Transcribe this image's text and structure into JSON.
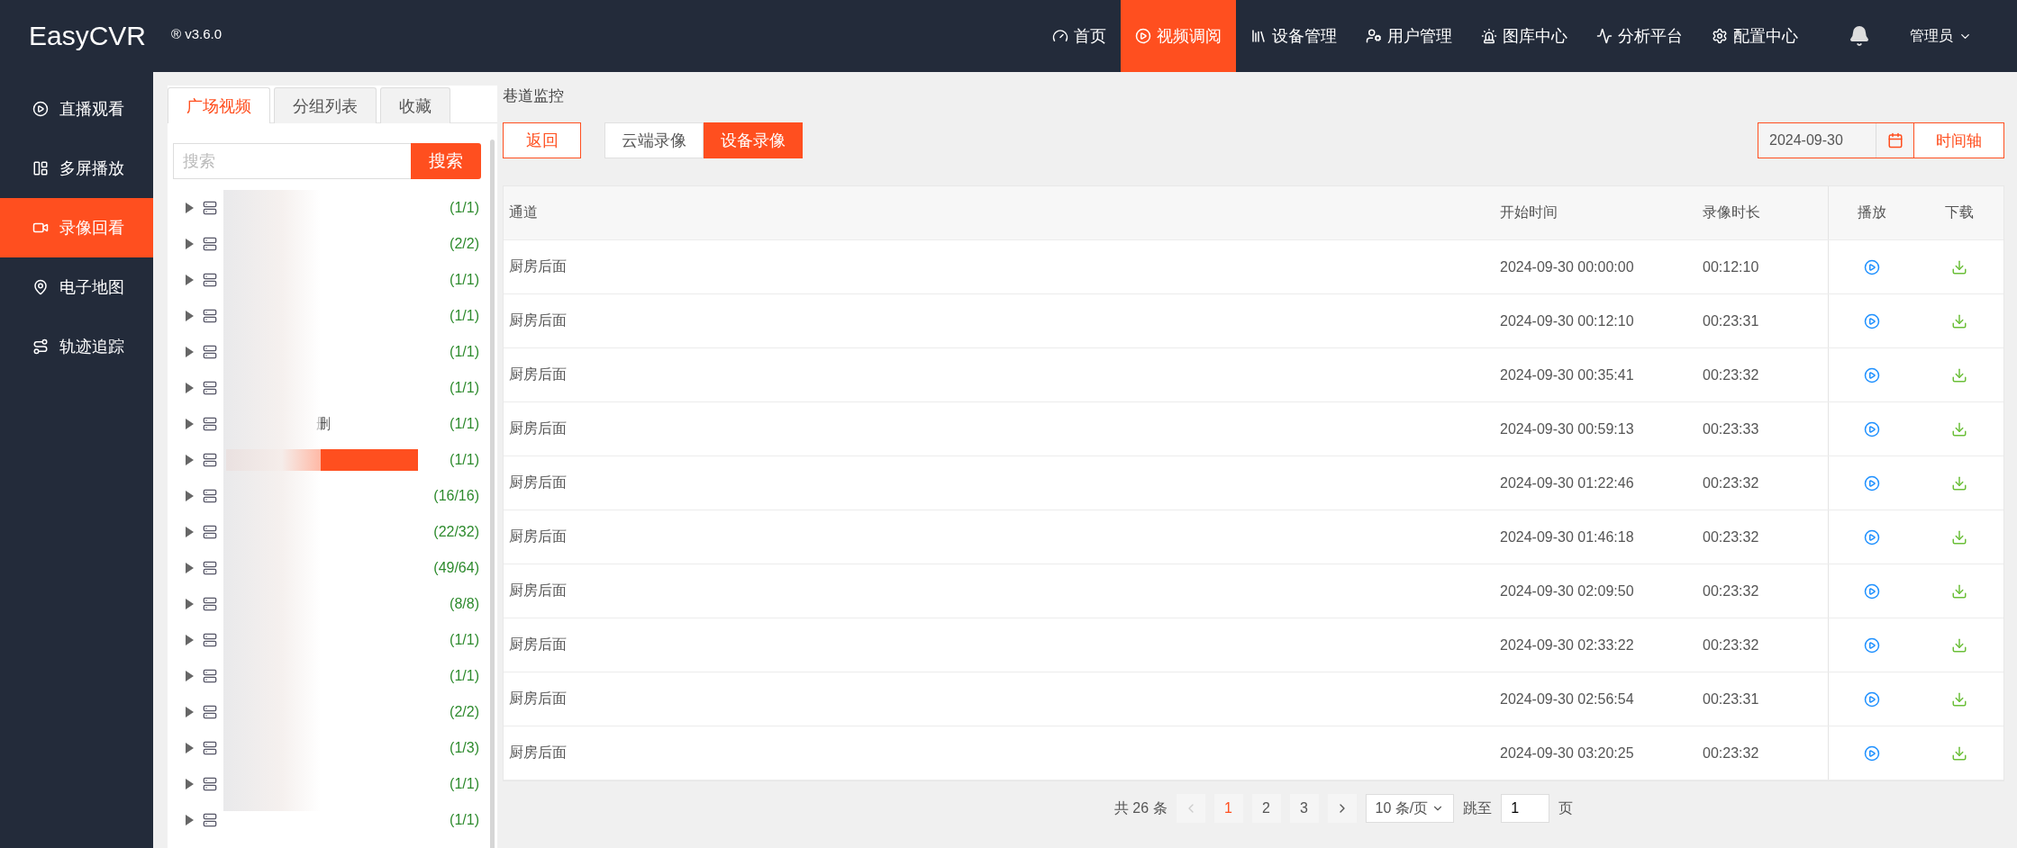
{
  "brand": {
    "name": "EasyCVR",
    "version": "® v3.6.0"
  },
  "nav": [
    {
      "label": "首页",
      "selected": false
    },
    {
      "label": "视频调阅",
      "selected": true
    },
    {
      "label": "设备管理",
      "selected": false
    },
    {
      "label": "用户管理",
      "selected": false
    },
    {
      "label": "图库中心",
      "selected": false
    },
    {
      "label": "分析平台",
      "selected": false
    },
    {
      "label": "配置中心",
      "selected": false
    }
  ],
  "user": "管理员",
  "sidebar": [
    {
      "label": "直播观看",
      "selected": false
    },
    {
      "label": "多屏播放",
      "selected": false
    },
    {
      "label": "录像回看",
      "selected": true
    },
    {
      "label": "电子地图",
      "selected": false
    },
    {
      "label": "轨迹追踪",
      "selected": false
    }
  ],
  "tree_tabs": [
    {
      "label": "广场视频",
      "selected": true
    },
    {
      "label": "分组列表",
      "selected": false
    },
    {
      "label": "收藏",
      "selected": false
    }
  ],
  "search": {
    "placeholder": "搜索",
    "button": "搜索"
  },
  "tree": [
    {
      "count": "(1/1)",
      "selected": false
    },
    {
      "count": "(2/2)",
      "selected": false
    },
    {
      "count": "(1/1)",
      "selected": false
    },
    {
      "count": "(1/1)",
      "selected": false
    },
    {
      "count": "(1/1)",
      "selected": false
    },
    {
      "count": "(1/1)",
      "selected": false
    },
    {
      "label": "删",
      "count": "(1/1)",
      "selected": false
    },
    {
      "count": "(1/1)",
      "selected": true
    },
    {
      "count": "(16/16)",
      "selected": false
    },
    {
      "count": "(22/32)",
      "selected": false
    },
    {
      "count": "(49/64)",
      "selected": false
    },
    {
      "count": "(8/8)",
      "selected": false
    },
    {
      "count": "(1/1)",
      "selected": false
    },
    {
      "count": "(1/1)",
      "selected": false
    },
    {
      "count": "(2/2)",
      "selected": false
    },
    {
      "count": "(1/3)",
      "selected": false
    },
    {
      "count": "(1/1)",
      "selected": false
    },
    {
      "count": "(1/1)",
      "selected": false
    }
  ],
  "breadcrumb": "巷道监控",
  "back_button": "返回",
  "source_toggle": [
    {
      "label": "云端录像",
      "selected": false
    },
    {
      "label": "设备录像",
      "selected": true
    }
  ],
  "date": "2024-09-30",
  "timeline_button": "时间轴",
  "table": {
    "columns": [
      "通道",
      "开始时间",
      "录像时长",
      "播放",
      "下载"
    ],
    "rows": [
      {
        "channel": "厨房后面",
        "start": "2024-09-30 00:00:00",
        "duration": "00:12:10"
      },
      {
        "channel": "厨房后面",
        "start": "2024-09-30 00:12:10",
        "duration": "00:23:31"
      },
      {
        "channel": "厨房后面",
        "start": "2024-09-30 00:35:41",
        "duration": "00:23:32"
      },
      {
        "channel": "厨房后面",
        "start": "2024-09-30 00:59:13",
        "duration": "00:23:33"
      },
      {
        "channel": "厨房后面",
        "start": "2024-09-30 01:22:46",
        "duration": "00:23:32"
      },
      {
        "channel": "厨房后面",
        "start": "2024-09-30 01:46:18",
        "duration": "00:23:32"
      },
      {
        "channel": "厨房后面",
        "start": "2024-09-30 02:09:50",
        "duration": "00:23:32"
      },
      {
        "channel": "厨房后面",
        "start": "2024-09-30 02:33:22",
        "duration": "00:23:32"
      },
      {
        "channel": "厨房后面",
        "start": "2024-09-30 02:56:54",
        "duration": "00:23:31"
      },
      {
        "channel": "厨房后面",
        "start": "2024-09-30 03:20:25",
        "duration": "00:23:32"
      }
    ]
  },
  "pagination": {
    "total": "共 26 条",
    "pages": [
      {
        "label": "1",
        "selected": true
      },
      {
        "label": "2",
        "selected": false
      },
      {
        "label": "3",
        "selected": false
      }
    ],
    "page_size": "10 条/页",
    "jump_label": "跳至",
    "jump_value": "1",
    "page_unit": "页"
  }
}
